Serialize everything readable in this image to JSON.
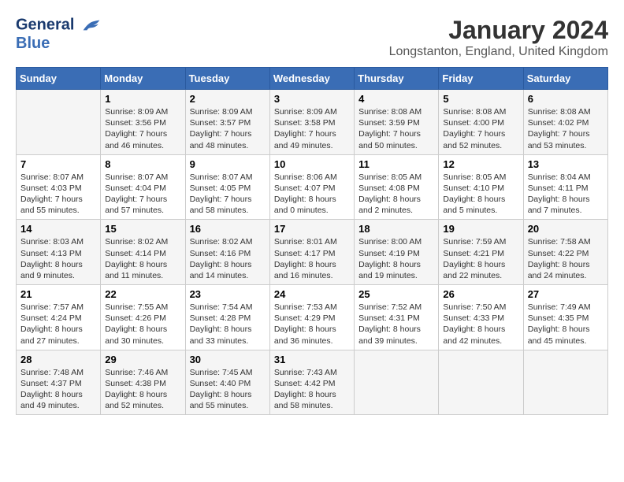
{
  "header": {
    "logo_line1": "General",
    "logo_line2": "Blue",
    "month_title": "January 2024",
    "location": "Longstanton, England, United Kingdom"
  },
  "days_of_week": [
    "Sunday",
    "Monday",
    "Tuesday",
    "Wednesday",
    "Thursday",
    "Friday",
    "Saturday"
  ],
  "weeks": [
    [
      {
        "day": "",
        "info": ""
      },
      {
        "day": "1",
        "info": "Sunrise: 8:09 AM\nSunset: 3:56 PM\nDaylight: 7 hours\nand 46 minutes."
      },
      {
        "day": "2",
        "info": "Sunrise: 8:09 AM\nSunset: 3:57 PM\nDaylight: 7 hours\nand 48 minutes."
      },
      {
        "day": "3",
        "info": "Sunrise: 8:09 AM\nSunset: 3:58 PM\nDaylight: 7 hours\nand 49 minutes."
      },
      {
        "day": "4",
        "info": "Sunrise: 8:08 AM\nSunset: 3:59 PM\nDaylight: 7 hours\nand 50 minutes."
      },
      {
        "day": "5",
        "info": "Sunrise: 8:08 AM\nSunset: 4:00 PM\nDaylight: 7 hours\nand 52 minutes."
      },
      {
        "day": "6",
        "info": "Sunrise: 8:08 AM\nSunset: 4:02 PM\nDaylight: 7 hours\nand 53 minutes."
      }
    ],
    [
      {
        "day": "7",
        "info": "Sunrise: 8:07 AM\nSunset: 4:03 PM\nDaylight: 7 hours\nand 55 minutes."
      },
      {
        "day": "8",
        "info": "Sunrise: 8:07 AM\nSunset: 4:04 PM\nDaylight: 7 hours\nand 57 minutes."
      },
      {
        "day": "9",
        "info": "Sunrise: 8:07 AM\nSunset: 4:05 PM\nDaylight: 7 hours\nand 58 minutes."
      },
      {
        "day": "10",
        "info": "Sunrise: 8:06 AM\nSunset: 4:07 PM\nDaylight: 8 hours\nand 0 minutes."
      },
      {
        "day": "11",
        "info": "Sunrise: 8:05 AM\nSunset: 4:08 PM\nDaylight: 8 hours\nand 2 minutes."
      },
      {
        "day": "12",
        "info": "Sunrise: 8:05 AM\nSunset: 4:10 PM\nDaylight: 8 hours\nand 5 minutes."
      },
      {
        "day": "13",
        "info": "Sunrise: 8:04 AM\nSunset: 4:11 PM\nDaylight: 8 hours\nand 7 minutes."
      }
    ],
    [
      {
        "day": "14",
        "info": "Sunrise: 8:03 AM\nSunset: 4:13 PM\nDaylight: 8 hours\nand 9 minutes."
      },
      {
        "day": "15",
        "info": "Sunrise: 8:02 AM\nSunset: 4:14 PM\nDaylight: 8 hours\nand 11 minutes."
      },
      {
        "day": "16",
        "info": "Sunrise: 8:02 AM\nSunset: 4:16 PM\nDaylight: 8 hours\nand 14 minutes."
      },
      {
        "day": "17",
        "info": "Sunrise: 8:01 AM\nSunset: 4:17 PM\nDaylight: 8 hours\nand 16 minutes."
      },
      {
        "day": "18",
        "info": "Sunrise: 8:00 AM\nSunset: 4:19 PM\nDaylight: 8 hours\nand 19 minutes."
      },
      {
        "day": "19",
        "info": "Sunrise: 7:59 AM\nSunset: 4:21 PM\nDaylight: 8 hours\nand 22 minutes."
      },
      {
        "day": "20",
        "info": "Sunrise: 7:58 AM\nSunset: 4:22 PM\nDaylight: 8 hours\nand 24 minutes."
      }
    ],
    [
      {
        "day": "21",
        "info": "Sunrise: 7:57 AM\nSunset: 4:24 PM\nDaylight: 8 hours\nand 27 minutes."
      },
      {
        "day": "22",
        "info": "Sunrise: 7:55 AM\nSunset: 4:26 PM\nDaylight: 8 hours\nand 30 minutes."
      },
      {
        "day": "23",
        "info": "Sunrise: 7:54 AM\nSunset: 4:28 PM\nDaylight: 8 hours\nand 33 minutes."
      },
      {
        "day": "24",
        "info": "Sunrise: 7:53 AM\nSunset: 4:29 PM\nDaylight: 8 hours\nand 36 minutes."
      },
      {
        "day": "25",
        "info": "Sunrise: 7:52 AM\nSunset: 4:31 PM\nDaylight: 8 hours\nand 39 minutes."
      },
      {
        "day": "26",
        "info": "Sunrise: 7:50 AM\nSunset: 4:33 PM\nDaylight: 8 hours\nand 42 minutes."
      },
      {
        "day": "27",
        "info": "Sunrise: 7:49 AM\nSunset: 4:35 PM\nDaylight: 8 hours\nand 45 minutes."
      }
    ],
    [
      {
        "day": "28",
        "info": "Sunrise: 7:48 AM\nSunset: 4:37 PM\nDaylight: 8 hours\nand 49 minutes."
      },
      {
        "day": "29",
        "info": "Sunrise: 7:46 AM\nSunset: 4:38 PM\nDaylight: 8 hours\nand 52 minutes."
      },
      {
        "day": "30",
        "info": "Sunrise: 7:45 AM\nSunset: 4:40 PM\nDaylight: 8 hours\nand 55 minutes."
      },
      {
        "day": "31",
        "info": "Sunrise: 7:43 AM\nSunset: 4:42 PM\nDaylight: 8 hours\nand 58 minutes."
      },
      {
        "day": "",
        "info": ""
      },
      {
        "day": "",
        "info": ""
      },
      {
        "day": "",
        "info": ""
      }
    ]
  ]
}
